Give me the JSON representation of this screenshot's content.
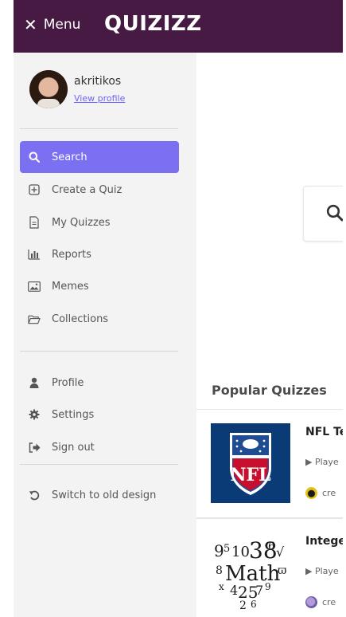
{
  "topbar": {
    "close_icon": "x-icon",
    "menu_label": "Menu",
    "logo_text": "QUIZIZZ",
    "bg_color": "#461a42"
  },
  "user": {
    "name": "akritikos",
    "view_profile": "View profile"
  },
  "nav": {
    "search": "Search",
    "create_quiz": "Create a Quiz",
    "my_quizzes": "My Quizzes",
    "reports": "Reports",
    "memes": "Memes",
    "collections": "Collections",
    "profile": "Profile",
    "settings": "Settings",
    "sign_out": "Sign out",
    "switch_design": "Switch to old design",
    "active_color": "#7b6ff2"
  },
  "main": {
    "popular_title": "Popular Quizzes",
    "quizzes": [
      {
        "title": "NFL Te",
        "play": "▶ Playe",
        "creator": "cre"
      },
      {
        "title": "Intege",
        "play": "▶ Playe",
        "creator": "cre"
      }
    ]
  }
}
